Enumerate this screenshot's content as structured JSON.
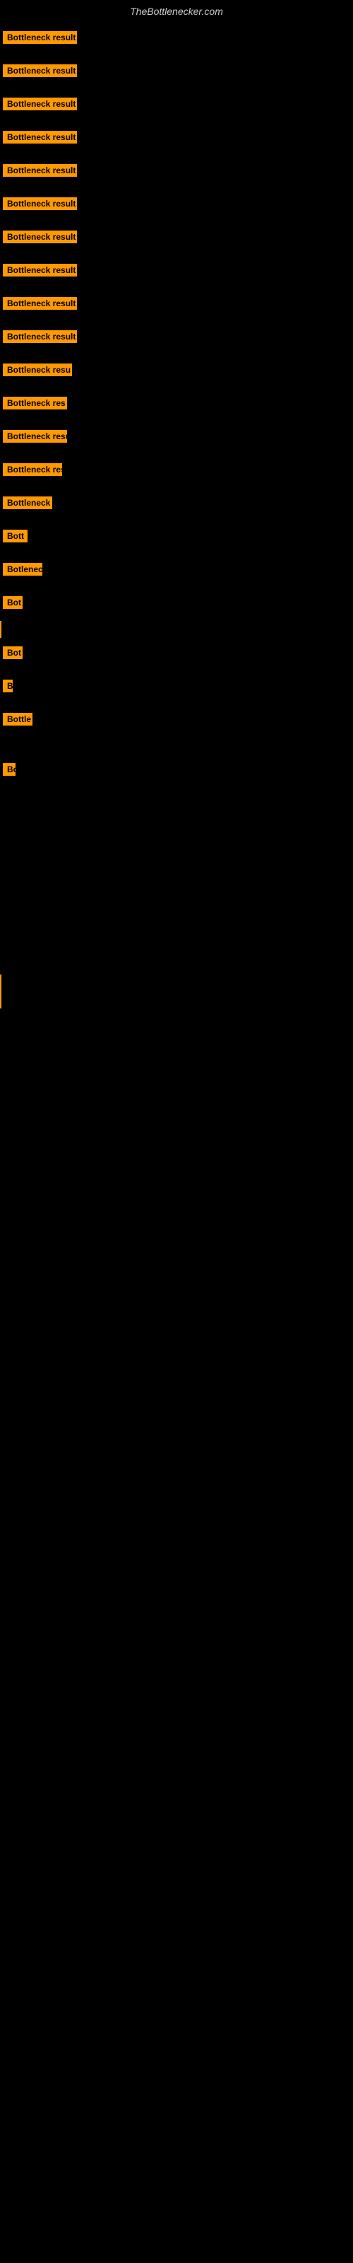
{
  "site_title": "TheBottlenecker.com",
  "badge_label": "Bottleneck result",
  "rows": [
    {
      "id": 1,
      "badge_text": "Bottleneck result",
      "has_left_bar": false,
      "badge_width": 105
    },
    {
      "id": 2,
      "badge_text": "Bottleneck result",
      "has_left_bar": false,
      "badge_width": 105
    },
    {
      "id": 3,
      "badge_text": "Bottleneck result",
      "has_left_bar": false,
      "badge_width": 105
    },
    {
      "id": 4,
      "badge_text": "Bottleneck result",
      "has_left_bar": false,
      "badge_width": 105
    },
    {
      "id": 5,
      "badge_text": "Bottleneck result",
      "has_left_bar": false,
      "badge_width": 105
    },
    {
      "id": 6,
      "badge_text": "Bottleneck result",
      "has_left_bar": false,
      "badge_width": 105
    },
    {
      "id": 7,
      "badge_text": "Bottleneck result",
      "has_left_bar": false,
      "badge_width": 105
    },
    {
      "id": 8,
      "badge_text": "Bottleneck result",
      "has_left_bar": false,
      "badge_width": 105
    },
    {
      "id": 9,
      "badge_text": "Bottleneck result",
      "has_left_bar": false,
      "badge_width": 105
    },
    {
      "id": 10,
      "badge_text": "Bottleneck result",
      "has_left_bar": false,
      "badge_width": 105
    },
    {
      "id": 11,
      "badge_text": "Bottleneck resu",
      "has_left_bar": false,
      "badge_width": 98
    },
    {
      "id": 12,
      "badge_text": "Bottleneck res",
      "has_left_bar": false,
      "badge_width": 91
    },
    {
      "id": 13,
      "badge_text": "Bottleneck resu",
      "has_left_bar": false,
      "badge_width": 91
    },
    {
      "id": 14,
      "badge_text": "Bottleneck res",
      "has_left_bar": false,
      "badge_width": 84
    },
    {
      "id": 15,
      "badge_text": "Bottleneck",
      "has_left_bar": false,
      "badge_width": 70
    },
    {
      "id": 16,
      "badge_text": "Bott",
      "has_left_bar": false,
      "badge_width": 35
    },
    {
      "id": 17,
      "badge_text": "Botlenec",
      "has_left_bar": false,
      "badge_width": 56
    },
    {
      "id": 18,
      "badge_text": "Bot",
      "has_left_bar": false,
      "badge_width": 28
    },
    {
      "id": 19,
      "badge_text": "",
      "has_left_bar": true,
      "badge_width": 0
    },
    {
      "id": 20,
      "badge_text": "Bot",
      "has_left_bar": false,
      "badge_width": 28
    },
    {
      "id": 21,
      "badge_text": "B",
      "has_left_bar": false,
      "badge_width": 14
    },
    {
      "id": 22,
      "badge_text": "Bottle",
      "has_left_bar": false,
      "badge_width": 42
    },
    {
      "id": 23,
      "badge_text": "",
      "has_left_bar": false,
      "badge_width": 0
    },
    {
      "id": 24,
      "badge_text": "Bo",
      "has_left_bar": false,
      "badge_width": 18
    },
    {
      "id": 25,
      "badge_text": "",
      "has_left_bar": false,
      "badge_width": 0
    },
    {
      "id": 26,
      "badge_text": "",
      "has_left_bar": false,
      "badge_width": 0
    },
    {
      "id": 27,
      "badge_text": "",
      "has_left_bar": false,
      "badge_width": 0
    },
    {
      "id": 28,
      "badge_text": "",
      "has_left_bar": false,
      "badge_width": 0
    },
    {
      "id": 29,
      "badge_text": "",
      "has_left_bar": false,
      "badge_width": 0
    },
    {
      "id": 30,
      "badge_text": "",
      "has_left_bar": false,
      "badge_width": 0
    },
    {
      "id": 31,
      "badge_text": "",
      "has_left_bar": false,
      "badge_width": 0
    },
    {
      "id": 32,
      "badge_text": "",
      "has_left_bar": false,
      "badge_width": 0
    },
    {
      "id": 33,
      "badge_text": "",
      "has_left_bar": false,
      "badge_width": 0
    },
    {
      "id": 34,
      "badge_text": "",
      "has_left_bar": false,
      "badge_width": 0
    },
    {
      "id": 35,
      "badge_text": "",
      "has_left_bar": false,
      "badge_width": 0
    },
    {
      "id": 36,
      "badge_text": "",
      "has_left_bar": true,
      "badge_width": 0
    },
    {
      "id": 37,
      "badge_text": "",
      "has_left_bar": true,
      "badge_width": 0
    }
  ]
}
